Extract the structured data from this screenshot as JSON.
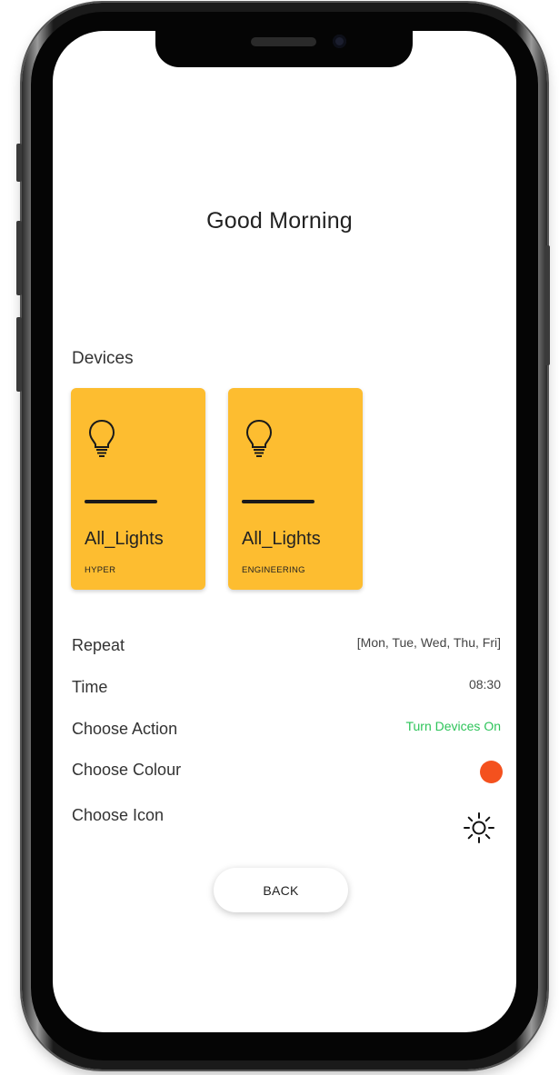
{
  "title": "Good Morning",
  "devices_label": "Devices",
  "devices": [
    {
      "name": "All_Lights",
      "group": "HYPER",
      "icon": "lightbulb-icon",
      "color": "#fdbd30"
    },
    {
      "name": "All_Lights",
      "group": "ENGINEERING",
      "icon": "lightbulb-icon",
      "color": "#fdbd30"
    }
  ],
  "settings": {
    "repeat": {
      "label": "Repeat",
      "value": "[Mon, Tue, Wed, Thu, Fri]"
    },
    "time": {
      "label": "Time",
      "value": "08:30"
    },
    "action": {
      "label": "Choose Action",
      "value": "Turn Devices On",
      "color": "#2ec45a"
    },
    "colour": {
      "label": "Choose Colour",
      "value_color": "#f4511e"
    },
    "icon": {
      "label": "Choose Icon",
      "value_icon": "sun-icon"
    }
  },
  "back_button": "BACK"
}
